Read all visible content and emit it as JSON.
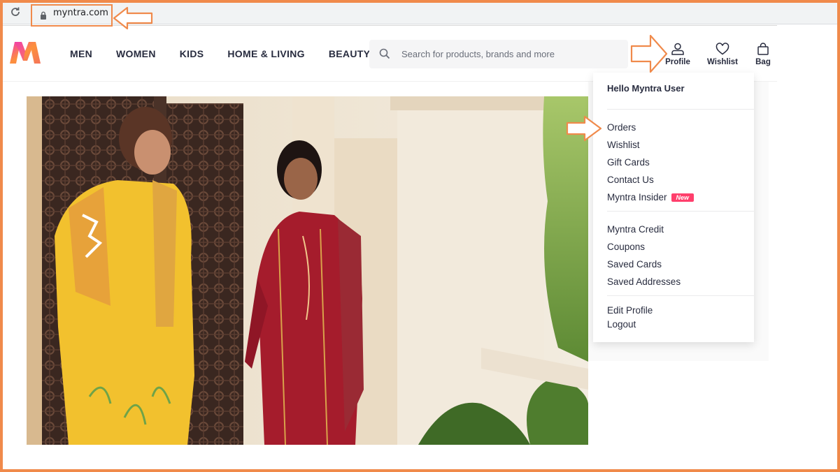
{
  "browser": {
    "url": "myntra.com",
    "reload_icon": "reload-icon",
    "lock_icon": "lock-icon"
  },
  "header": {
    "logo_icon": "myntra-logo",
    "nav": [
      "MEN",
      "WOMEN",
      "KIDS",
      "HOME & LIVING",
      "BEAUTY"
    ],
    "search": {
      "placeholder": "Search for products, brands and more",
      "icon": "search-icon"
    },
    "actions": [
      {
        "label": "Profile",
        "icon": "user-icon"
      },
      {
        "label": "Wishlist",
        "icon": "heart-icon"
      },
      {
        "label": "Bag",
        "icon": "bag-icon"
      }
    ]
  },
  "profile_menu": {
    "greeting": "Hello Myntra User",
    "group1": [
      "Orders",
      "Wishlist",
      "Gift Cards",
      "Contact Us",
      "Myntra Insider"
    ],
    "insider_badge": "New",
    "group2": [
      "Myntra Credit",
      "Coupons",
      "Saved Cards",
      "Saved Addresses"
    ],
    "group3": [
      "Edit Profile",
      "Logout"
    ]
  },
  "colors": {
    "accent": "#ff3f6c",
    "annotation": "#f08a4b",
    "text": "#282c3f"
  }
}
